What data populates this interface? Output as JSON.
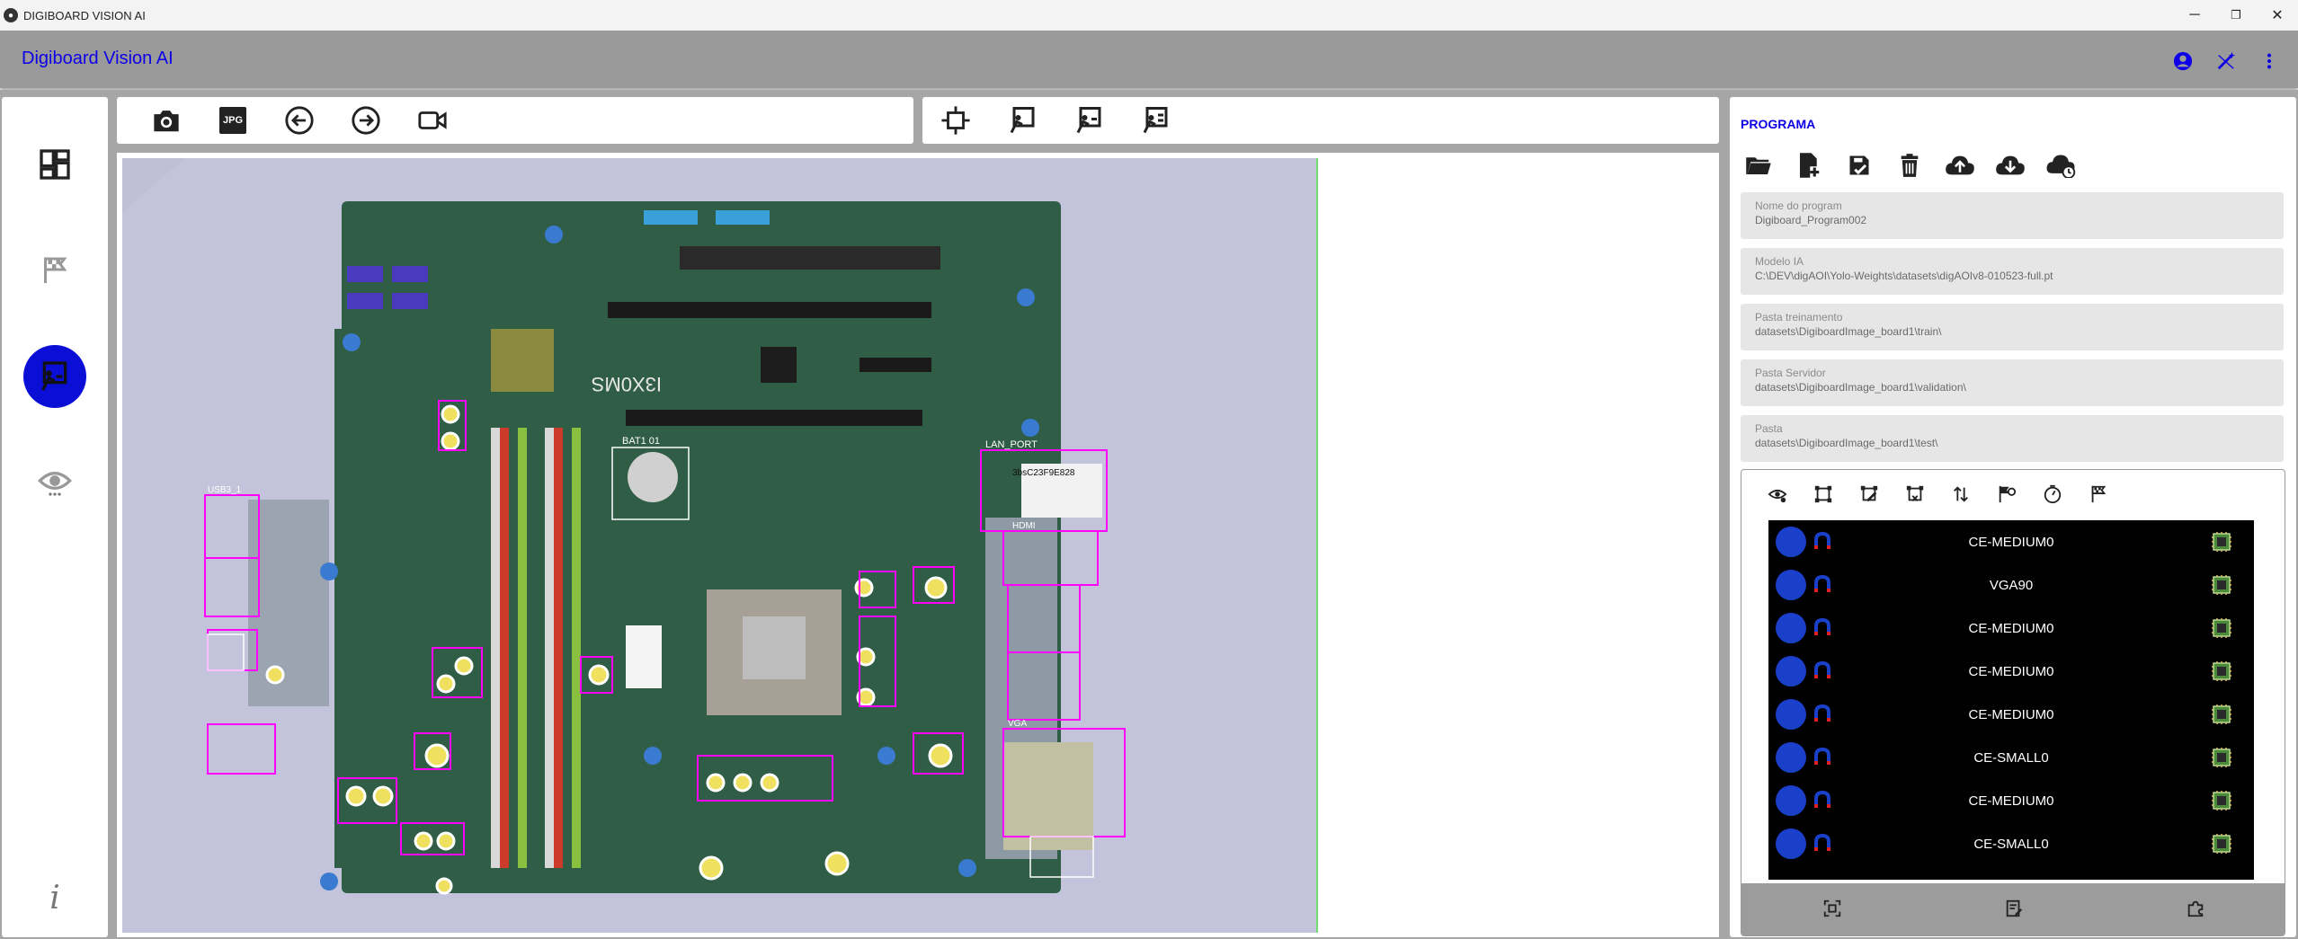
{
  "window": {
    "title": "DIGIBOARD VISION AI",
    "minimize": "─",
    "restore": "❐",
    "close": "✕"
  },
  "appbar": {
    "title": "Digiboard Vision AI"
  },
  "nav": {
    "items": [
      "dashboard-icon",
      "flag-icon",
      "inspect-icon",
      "view-icon"
    ],
    "info": "i"
  },
  "toolbar": {
    "capture_icons": [
      "camera-icon",
      "jpg-icon",
      "back-icon",
      "forward-icon",
      "video-icon"
    ],
    "jpg_label": "JPG",
    "inspect_icons": [
      "crop-icon",
      "inspect-a-icon",
      "inspect-b-icon",
      "inspect-c-icon"
    ]
  },
  "program": {
    "title": "PROGRAMA",
    "file_actions": [
      "open-folder-icon",
      "new-file-icon",
      "save-icon",
      "delete-icon",
      "upload-cloud-icon",
      "download-cloud-icon",
      "cloud-sync-icon"
    ],
    "fields": [
      {
        "label": "Nome do program",
        "value": "Digiboard_Program002"
      },
      {
        "label": "Modelo IA",
        "value": "C:\\DEV\\digAOI\\Yolo-Weights\\datasets\\digAOIv8-010523-full.pt"
      },
      {
        "label": "Pasta treinamento",
        "value": "datasets\\DigiboardImage_board1\\train\\"
      },
      {
        "label": "Pasta Servidor",
        "value": "datasets\\DigiboardImage_board1\\validation\\"
      },
      {
        "label": "Pasta",
        "value": "datasets\\DigiboardImage_board1\\test\\"
      }
    ]
  },
  "component_list": {
    "tools": [
      "eye-settings-icon",
      "select-icon",
      "edit-box-icon",
      "remove-box-icon",
      "sort-icon",
      "flag-settings-icon",
      "timer-icon",
      "flag-icon"
    ],
    "rows": [
      "CE-MEDIUM0",
      "VGA90",
      "CE-MEDIUM0",
      "CE-MEDIUM0",
      "CE-MEDIUM0",
      "CE-SMALL0",
      "CE-MEDIUM0",
      "CE-SMALL0"
    ],
    "footer": [
      "scan-icon",
      "list-edit-icon",
      "puzzle-icon"
    ]
  },
  "board": {
    "labels": {
      "bat": "BAT1 01",
      "lan": "LAN_PORT",
      "barcode": "3bsC23F9E828",
      "hdmi": "HDMI",
      "vga": "VGA",
      "usb": "USB3_1",
      "model": "I3X0MS"
    }
  },
  "colors": {
    "accent": "#0d00e6",
    "active_nav": "#0b0fd6",
    "annotation": "#ff00ff",
    "list_bg": "#000000"
  }
}
